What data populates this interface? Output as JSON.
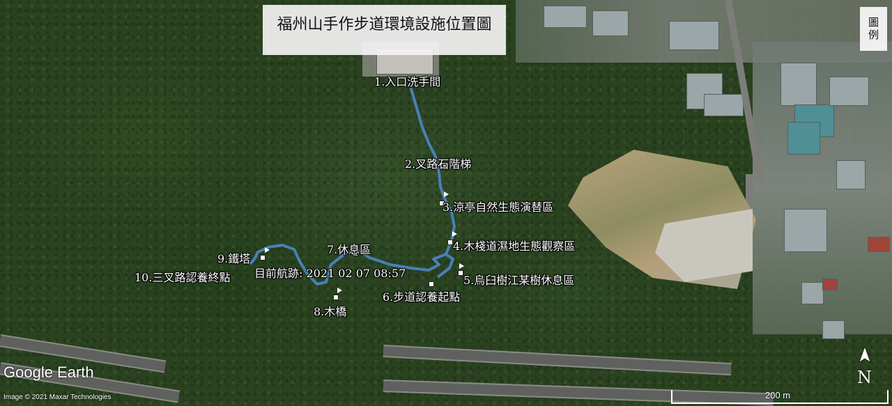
{
  "map": {
    "title": "福州山手作步道環境設施位置圖",
    "legend_button": "圖例",
    "trail_color": "#4a7fb8",
    "waypoints": [
      {
        "label": "1.入口洗手間"
      },
      {
        "label": "2.叉路石階梯"
      },
      {
        "label": "3.涼亭自然生態演替區"
      },
      {
        "label": "4.木棧道濕地生態觀察區"
      },
      {
        "label": "5.烏臼樹江某樹休息區"
      },
      {
        "label": "6.步道認養起點"
      },
      {
        "label": "7.休息區"
      },
      {
        "label": "8.木橋"
      },
      {
        "label": "9.鐵塔"
      },
      {
        "label": "10.三叉路認養終點"
      }
    ],
    "track_label": "目前航跡: 2021 02 07 08:57",
    "branding": "Google Earth",
    "copyright": "Image © 2021 Maxar Technologies",
    "scale_label": "200 m",
    "north_label": "N"
  }
}
